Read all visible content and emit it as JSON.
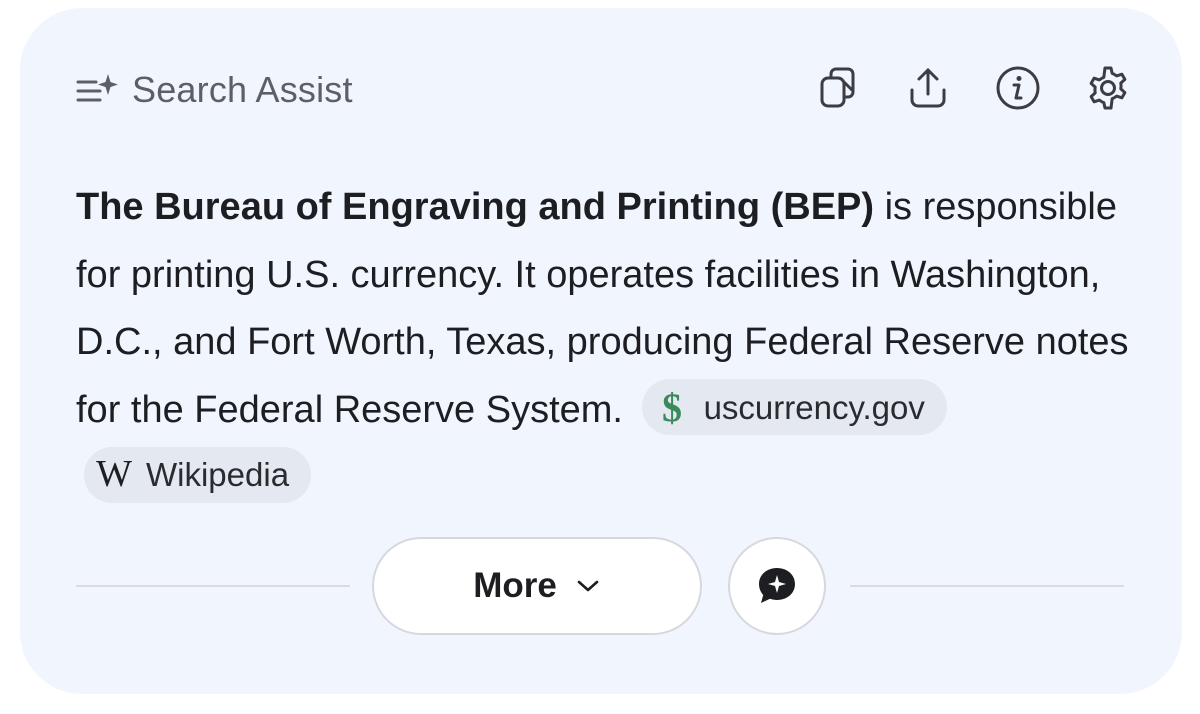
{
  "header": {
    "title": "Search Assist",
    "icon": "sparkle-list-icon",
    "toolbar": [
      {
        "name": "copy-icon"
      },
      {
        "name": "share-icon"
      },
      {
        "name": "info-icon"
      },
      {
        "name": "settings-icon"
      }
    ]
  },
  "answer": {
    "bold_lead": "The Bureau of Engraving and Printing (BEP)",
    "text": " is responsible for printing U.S. currency. It operates facilities in Washington, D.C., and Fort Worth, Texas, producing Federal Reserve notes for the Federal Reserve System. ",
    "sources": [
      {
        "label": "uscurrency.gov",
        "icon": "dollar-icon"
      },
      {
        "label": "Wikipedia",
        "icon": "wikipedia-icon",
        "glyph": "W"
      }
    ]
  },
  "actions": {
    "more_label": "More",
    "chat_icon": "chat-sparkle-icon"
  },
  "colors": {
    "card_background": "#f1f5fd",
    "dollar_green": "#3a8a5c",
    "text": "#1d1e22",
    "muted": "#5d5f66"
  }
}
